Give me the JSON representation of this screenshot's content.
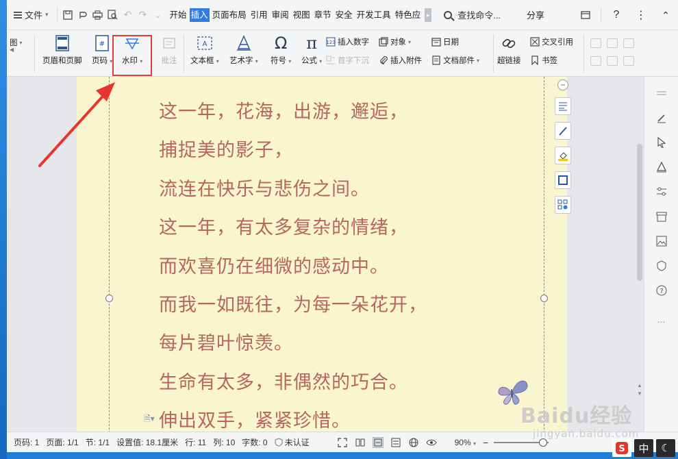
{
  "menubar": {
    "file_label": "文件",
    "tabs": [
      {
        "label": "开始",
        "active": false
      },
      {
        "label": "插入",
        "active": true
      },
      {
        "label": "页面布局",
        "active": false
      },
      {
        "label": "引用",
        "active": false
      },
      {
        "label": "审阅",
        "active": false
      },
      {
        "label": "视图",
        "active": false
      },
      {
        "label": "章节",
        "active": false
      },
      {
        "label": "安全",
        "active": false
      },
      {
        "label": "开发工具",
        "active": false
      },
      {
        "label": "特色应",
        "active": false
      }
    ],
    "search_label": "查找命令...",
    "share_label": "分享"
  },
  "ribbon": {
    "cut_label": "图",
    "header_footer": "页眉和页脚",
    "page_number": "页码",
    "watermark": "水印",
    "comment": "批注",
    "textbox": "文本框",
    "wordart": "艺术字",
    "symbol": "符号",
    "formula": "公式",
    "insert_number": "插入数字",
    "object": "对象",
    "date": "日期",
    "drop_cap": "首字下沉",
    "insert_attachment": "插入附件",
    "doc_parts": "文档部件",
    "hyperlink": "超链接",
    "cross_ref": "交叉引用",
    "bookmark": "书签"
  },
  "document": {
    "lines": [
      "这一年，花海，出游，邂逅，",
      "捕捉美的影子，",
      "流连在快乐与悲伤之间。",
      "这一年，有太多复杂的情绪，",
      "而欢喜仍在细微的感动中。",
      "而我一如既往，为每一朵花开，",
      "每片碧叶惊羡。",
      "生命有太多，非偶然的巧合。",
      "伸出双手，紧紧珍惜。"
    ]
  },
  "statusbar": {
    "page_code": "页码: 1",
    "page": "页面: 1/1",
    "section": "节: 1/1",
    "setting": "设置值: 18.1厘米",
    "row": "行: 11",
    "col": "列: 10",
    "word_count": "字数: 0",
    "cert": "未认证",
    "zoom": "90%"
  },
  "tray": {
    "ime_label": "中"
  },
  "watermark_overlay": {
    "brand": "Baidu经验",
    "url": "jingyan.baidu.com"
  },
  "colors": {
    "accent": "#2f7de1",
    "highlight_box": "#e23b3b",
    "page_bg": "#f9f6cf",
    "poem_text": "#b8655c"
  }
}
